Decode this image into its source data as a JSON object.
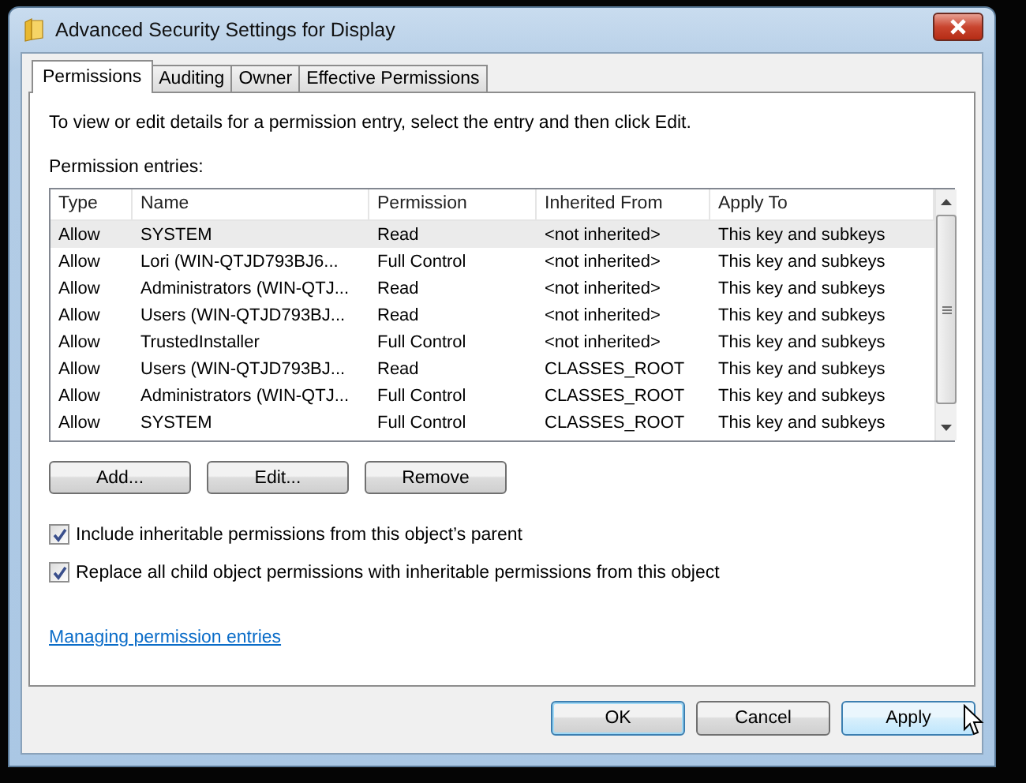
{
  "window": {
    "title": "Advanced Security Settings for Display"
  },
  "tabs": [
    {
      "label": "Permissions",
      "selected": true
    },
    {
      "label": "Auditing",
      "selected": false
    },
    {
      "label": "Owner",
      "selected": false
    },
    {
      "label": "Effective Permissions",
      "selected": false
    }
  ],
  "instruction": "To view or edit details for a permission entry, select the entry and then click Edit.",
  "entries_label": "Permission entries:",
  "table": {
    "columns": [
      "Type",
      "Name",
      "Permission",
      "Inherited From",
      "Apply To"
    ],
    "rows": [
      {
        "cells": [
          "Allow",
          "SYSTEM",
          "Read",
          "<not inherited>",
          "This key and subkeys"
        ],
        "selected": true
      },
      {
        "cells": [
          "Allow",
          "Lori (WIN-QTJD793BJ6...",
          "Full Control",
          "<not inherited>",
          "This key and subkeys"
        ],
        "selected": false
      },
      {
        "cells": [
          "Allow",
          "Administrators (WIN-QTJ...",
          "Read",
          "<not inherited>",
          "This key and subkeys"
        ],
        "selected": false
      },
      {
        "cells": [
          "Allow",
          "Users (WIN-QTJD793BJ...",
          "Read",
          "<not inherited>",
          "This key and subkeys"
        ],
        "selected": false
      },
      {
        "cells": [
          "Allow",
          "TrustedInstaller",
          "Full Control",
          "<not inherited>",
          "This key and subkeys"
        ],
        "selected": false
      },
      {
        "cells": [
          "Allow",
          "Users (WIN-QTJD793BJ...",
          "Read",
          "CLASSES_ROOT",
          "This key and subkeys"
        ],
        "selected": false
      },
      {
        "cells": [
          "Allow",
          "Administrators (WIN-QTJ...",
          "Full Control",
          "CLASSES_ROOT",
          "This key and subkeys"
        ],
        "selected": false
      },
      {
        "cells": [
          "Allow",
          "SYSTEM",
          "Full Control",
          "CLASSES_ROOT",
          "This key and subkeys"
        ],
        "selected": false
      }
    ]
  },
  "entry_buttons": [
    "Add...",
    "Edit...",
    "Remove"
  ],
  "options": [
    {
      "label": "Include inheritable permissions from this object’s parent",
      "checked": true
    },
    {
      "label": "Replace all child object permissions with inheritable permissions from this object",
      "checked": true
    }
  ],
  "help_link": "Managing permission entries",
  "dialog_buttons": [
    {
      "label": "OK",
      "default": true,
      "hovered": false
    },
    {
      "label": "Cancel",
      "default": false,
      "hovered": false
    },
    {
      "label": "Apply",
      "default": false,
      "hovered": true
    }
  ]
}
